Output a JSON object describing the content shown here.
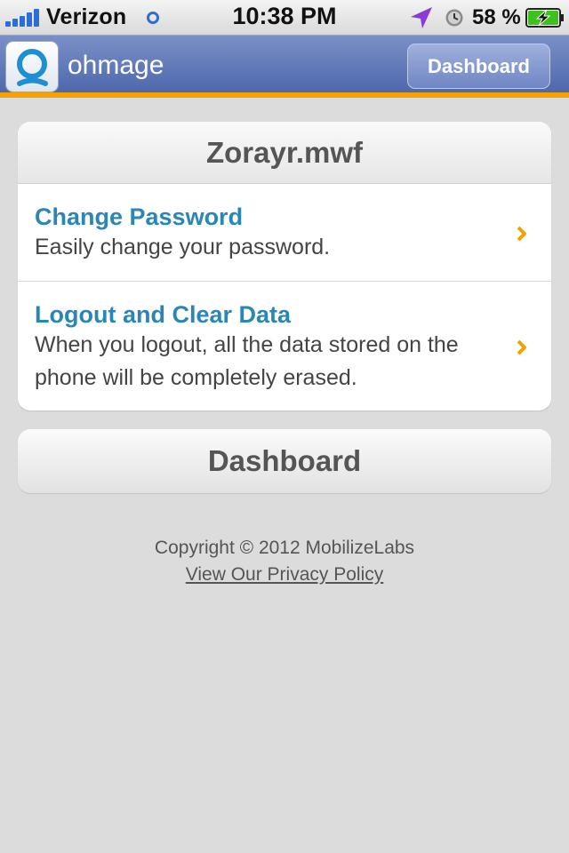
{
  "status_bar": {
    "carrier": "Verizon",
    "time": "10:38 PM",
    "battery_percent": "58 %",
    "signal_bars": 5,
    "icons": [
      "signal-icon",
      "network-activity-icon",
      "location-arrow-icon",
      "alarm-clock-icon",
      "battery-charging-icon"
    ]
  },
  "header": {
    "title": "ohmage",
    "dashboard_button": "Dashboard",
    "logo_icon": "ohmage-logo-icon"
  },
  "account": {
    "username": "Zorayr.mwf",
    "items": [
      {
        "title": "Change Password",
        "description": "Easily change your password.",
        "icon": "chevron-right-icon"
      },
      {
        "title": "Logout and Clear Data",
        "description": "When you logout, all the data stored on the phone will be completely erased.",
        "icon": "chevron-right-icon"
      }
    ]
  },
  "dashboard_button": "Dashboard",
  "footer": {
    "copyright": "Copyright © 2012 MobilizeLabs",
    "privacy_link": "View Our Privacy Policy"
  },
  "colors": {
    "header_gradient_top": "#7a90c8",
    "header_gradient_bottom": "#4e68ac",
    "header_accent": "#f5a200",
    "link_blue": "#2b86b8",
    "chevron": "#f5a200",
    "background": "#dcdcdc"
  }
}
